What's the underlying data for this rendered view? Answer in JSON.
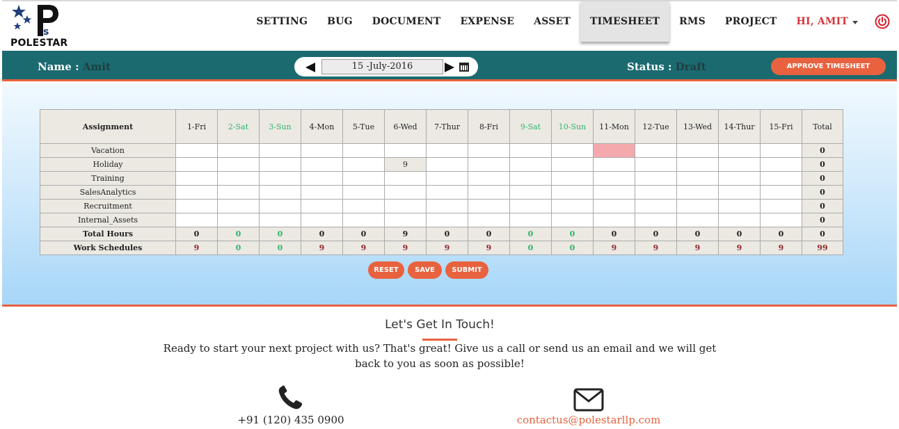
{
  "brand": {
    "logo_text": "POLESTAR",
    "primary_color": "#1b6a70",
    "accent_color": "#e9623f"
  },
  "nav": {
    "items": [
      {
        "label": "SETTING"
      },
      {
        "label": "BUG"
      },
      {
        "label": "DOCUMENT"
      },
      {
        "label": "EXPENSE"
      },
      {
        "label": "ASSET"
      },
      {
        "label": "TIMESHEET",
        "active": true
      },
      {
        "label": "RMS"
      },
      {
        "label": "PROJECT"
      }
    ],
    "user_label": "HI, AMIT",
    "power_icon": "power-icon"
  },
  "header": {
    "name_label": "Name :",
    "name_value": "Amit",
    "date_value": "15 -July-2016",
    "status_label": "Status :",
    "status_value": "Draft",
    "approve_label": "APPROVE TIMESHEET"
  },
  "timesheet": {
    "assignment_header": "Assignment",
    "total_header": "Total",
    "days": [
      {
        "label": "1-Fri",
        "weekend": false
      },
      {
        "label": "2-Sat",
        "weekend": true
      },
      {
        "label": "3-Sun",
        "weekend": true
      },
      {
        "label": "4-Mon",
        "weekend": false
      },
      {
        "label": "5-Tue",
        "weekend": false
      },
      {
        "label": "6-Wed",
        "weekend": false
      },
      {
        "label": "7-Thur",
        "weekend": false
      },
      {
        "label": "8-Fri",
        "weekend": false
      },
      {
        "label": "9-Sat",
        "weekend": true
      },
      {
        "label": "10-Sun",
        "weekend": true
      },
      {
        "label": "11-Mon",
        "weekend": false
      },
      {
        "label": "12-Tue",
        "weekend": false
      },
      {
        "label": "13-Wed",
        "weekend": false
      },
      {
        "label": "14-Thur",
        "weekend": false
      },
      {
        "label": "15-Fri",
        "weekend": false
      }
    ],
    "rows": [
      {
        "label": "Vacation",
        "cells": [
          "",
          "",
          "",
          "",
          "",
          "",
          "",
          "",
          "",
          "",
          "",
          "",
          "",
          "",
          ""
        ],
        "total": "0"
      },
      {
        "label": "Holiday",
        "cells": [
          "",
          "",
          "",
          "",
          "",
          "9",
          "",
          "",
          "",
          "",
          "",
          "",
          "",
          "",
          ""
        ],
        "total": "0"
      },
      {
        "label": "Training",
        "cells": [
          "",
          "",
          "",
          "",
          "",
          "",
          "",
          "",
          "",
          "",
          "",
          "",
          "",
          "",
          ""
        ],
        "total": "0"
      },
      {
        "label": "SalesAnalytics",
        "cells": [
          "",
          "",
          "",
          "",
          "",
          "",
          "",
          "",
          "",
          "",
          "",
          "",
          "",
          "",
          ""
        ],
        "total": "0"
      },
      {
        "label": "Recruitment",
        "cells": [
          "",
          "",
          "",
          "",
          "",
          "",
          "",
          "",
          "",
          "",
          "",
          "",
          "",
          "",
          ""
        ],
        "total": "0"
      },
      {
        "label": "Internal_Assets",
        "cells": [
          "",
          "",
          "",
          "",
          "",
          "",
          "",
          "",
          "",
          "",
          "",
          "",
          "",
          "",
          ""
        ],
        "total": "0"
      }
    ],
    "total_hours_label": "Total Hours",
    "total_hours": [
      "0",
      "0",
      "0",
      "0",
      "0",
      "9",
      "0",
      "0",
      "0",
      "0",
      "0",
      "0",
      "0",
      "0",
      "0"
    ],
    "total_hours_total": "0",
    "work_schedules_label": "Work Schedules",
    "work_schedules": [
      "9",
      "0",
      "0",
      "9",
      "9",
      "9",
      "9",
      "9",
      "0",
      "0",
      "9",
      "9",
      "9",
      "9",
      "9"
    ],
    "work_schedules_total": "99",
    "highlight_color": "#f4a9ad",
    "weekend_color": "#2fb56b"
  },
  "actions": {
    "reset": "RESET",
    "save": "SAVE",
    "submit": "SUBMIT"
  },
  "contact": {
    "title": "Let's Get In Touch!",
    "text": "Ready to start your next project with us? That's great! Give us a call or send us an email and we will get back to you as soon as possible!",
    "phone": "+91 (120) 435 0900",
    "email": "contactus@polestarllp.com"
  }
}
